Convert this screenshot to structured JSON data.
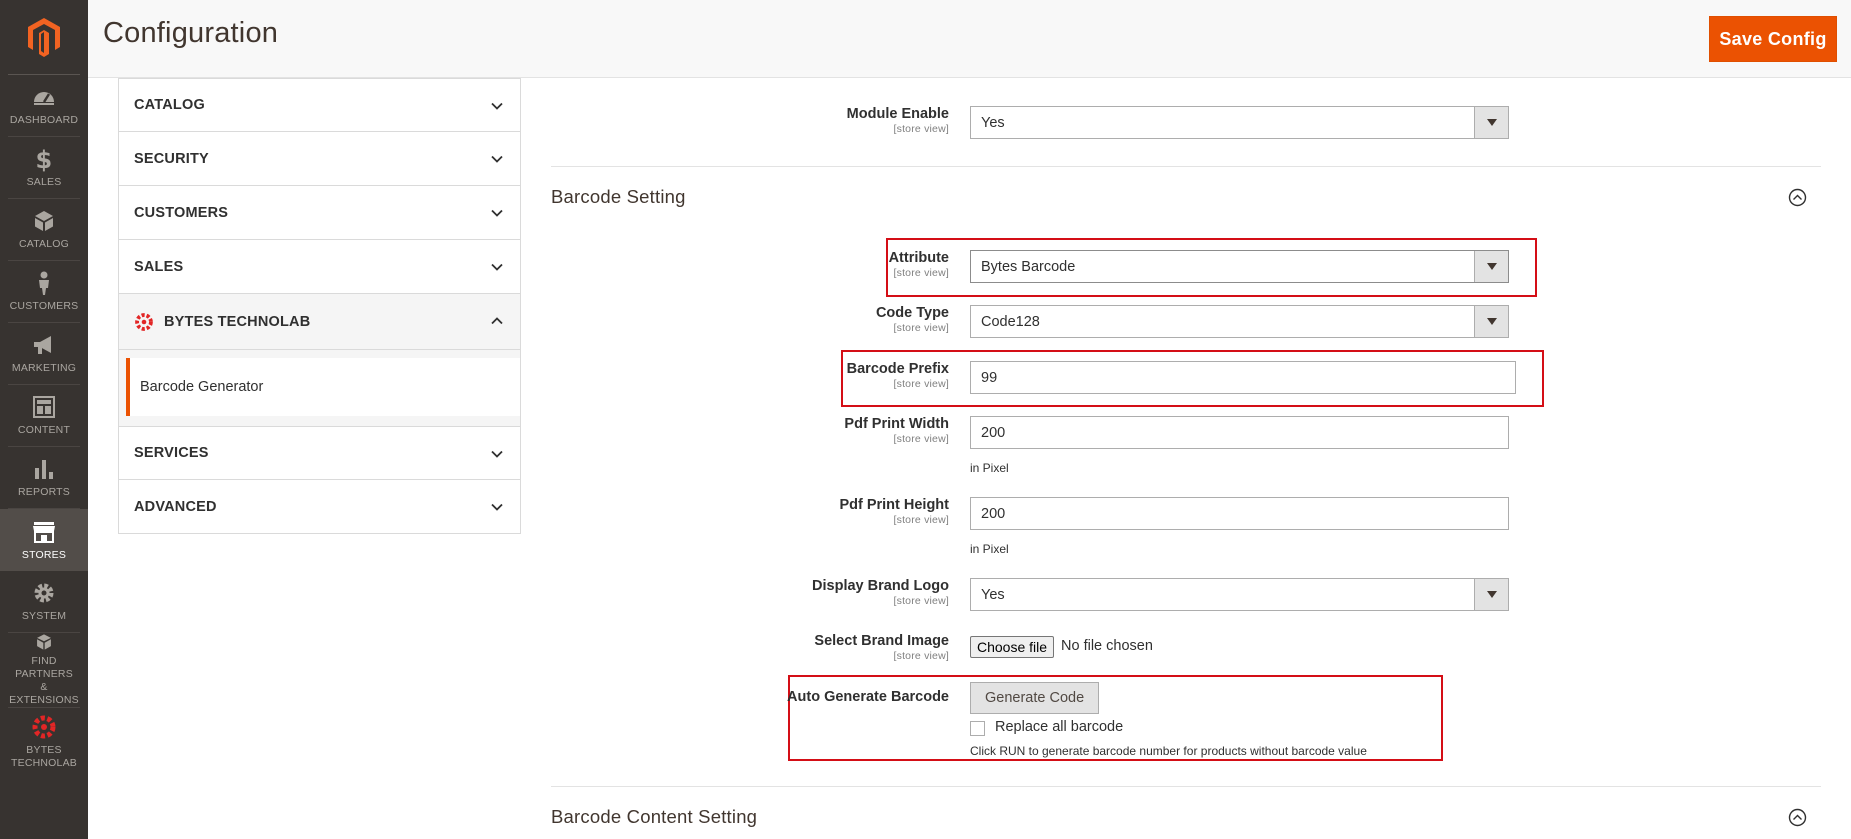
{
  "nav": {
    "items": [
      {
        "label": "DASHBOARD",
        "icon": "dashboard-icon"
      },
      {
        "label": "$",
        "text": "SALES",
        "icon": "dollar-icon"
      },
      {
        "label": "CATALOG",
        "icon": "box-icon"
      },
      {
        "label": "CUSTOMERS",
        "icon": "person-icon"
      },
      {
        "label": "MARKETING",
        "icon": "megaphone-icon"
      },
      {
        "label": "CONTENT",
        "icon": "layout-icon"
      },
      {
        "label": "REPORTS",
        "icon": "bar-chart-icon"
      },
      {
        "label": "STORES",
        "icon": "store-icon"
      },
      {
        "label": "SYSTEM",
        "icon": "gear-icon"
      },
      {
        "label": "FIND PARTNERS\n& EXTENSIONS",
        "icon": "package-icon"
      },
      {
        "label": "BYTES\nTECHNOLAB",
        "icon": "bytes-logo-icon"
      }
    ],
    "labels": {
      "dashboard": "DASHBOARD",
      "sales": "SALES",
      "catalog": "CATALOG",
      "customers": "CUSTOMERS",
      "marketing": "MARKETING",
      "content": "CONTENT",
      "reports": "REPORTS",
      "stores": "STORES",
      "system": "SYSTEM",
      "partners_1": "FIND PARTNERS",
      "partners_2": "& EXTENSIONS",
      "bytes_1": "BYTES",
      "bytes_2": "TECHNOLAB"
    },
    "active": "STORES"
  },
  "header": {
    "title": "Configuration",
    "save_label": "Save Config"
  },
  "tabs": {
    "catalog": "CATALOG",
    "security": "SECURITY",
    "customers": "CUSTOMERS",
    "sales": "SALES",
    "bytes": "BYTES TECHNOLAB",
    "barcode_generator": "Barcode Generator",
    "services": "SERVICES",
    "advanced": "ADVANCED"
  },
  "form": {
    "scope": "[store view]",
    "module_enable": {
      "label": "Module Enable",
      "value": "Yes"
    },
    "barcode_setting_title": "Barcode Setting",
    "attribute": {
      "label": "Attribute",
      "value": "Bytes Barcode"
    },
    "code_type": {
      "label": "Code Type",
      "value": "Code128"
    },
    "barcode_prefix": {
      "label": "Barcode Prefix",
      "value": "99"
    },
    "pdf_width": {
      "label": "Pdf Print Width",
      "value": "200",
      "note": "in Pixel"
    },
    "pdf_height": {
      "label": "Pdf Print Height",
      "value": "200",
      "note": "in Pixel"
    },
    "brand_logo": {
      "label": "Display Brand Logo",
      "value": "Yes"
    },
    "brand_image": {
      "label": "Select Brand Image",
      "button": "Choose file",
      "status": "No file chosen"
    },
    "auto_generate": {
      "label": "Auto Generate Barcode",
      "button": "Generate Code",
      "checkbox_label": "Replace all barcode",
      "note": "Click RUN to generate barcode number for products without barcode value"
    },
    "content_setting_title": "Barcode Content Setting"
  },
  "colors": {
    "accent": "#eb5202",
    "sidebar": "#373330",
    "highlight_box": "#d40e16"
  }
}
